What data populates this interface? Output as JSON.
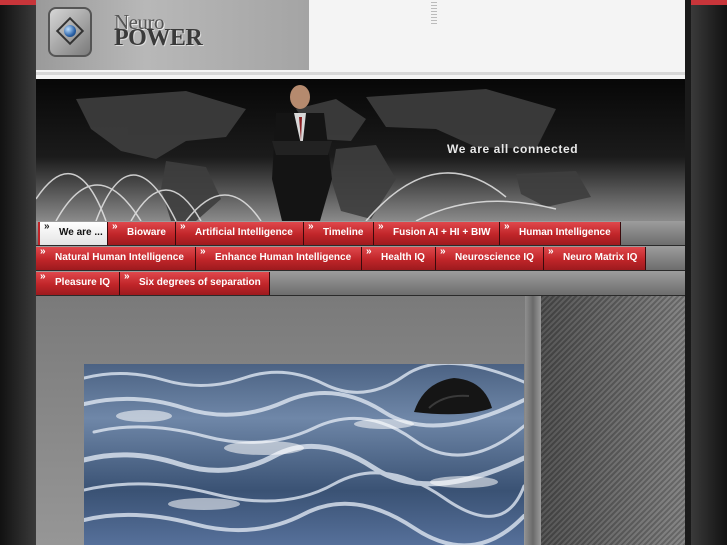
{
  "logo": {
    "line1": "Neuro",
    "line2": "POWER",
    "icon": "neuro-power-logo-icon"
  },
  "banner": {
    "tagline": "We are all connected"
  },
  "nav": {
    "row1": [
      {
        "label": "We are ...",
        "active": true
      },
      {
        "label": "Bioware"
      },
      {
        "label": "Artificial Intelligence"
      },
      {
        "label": "Timeline"
      },
      {
        "label": "Fusion AI + HI + BIW"
      },
      {
        "label": "Human Intelligence"
      }
    ],
    "row2": [
      {
        "label": "Natural Human Intelligence"
      },
      {
        "label": "Enhance Human Intelligence"
      },
      {
        "label": "Health IQ"
      },
      {
        "label": "Neuroscience IQ"
      },
      {
        "label": "Neuro Matrix IQ"
      }
    ],
    "row3": [
      {
        "label": "Pleasure IQ"
      },
      {
        "label": "Six degrees of separation"
      }
    ]
  },
  "colors": {
    "nav_red": "#c02529",
    "accent_red": "#c8353a"
  }
}
